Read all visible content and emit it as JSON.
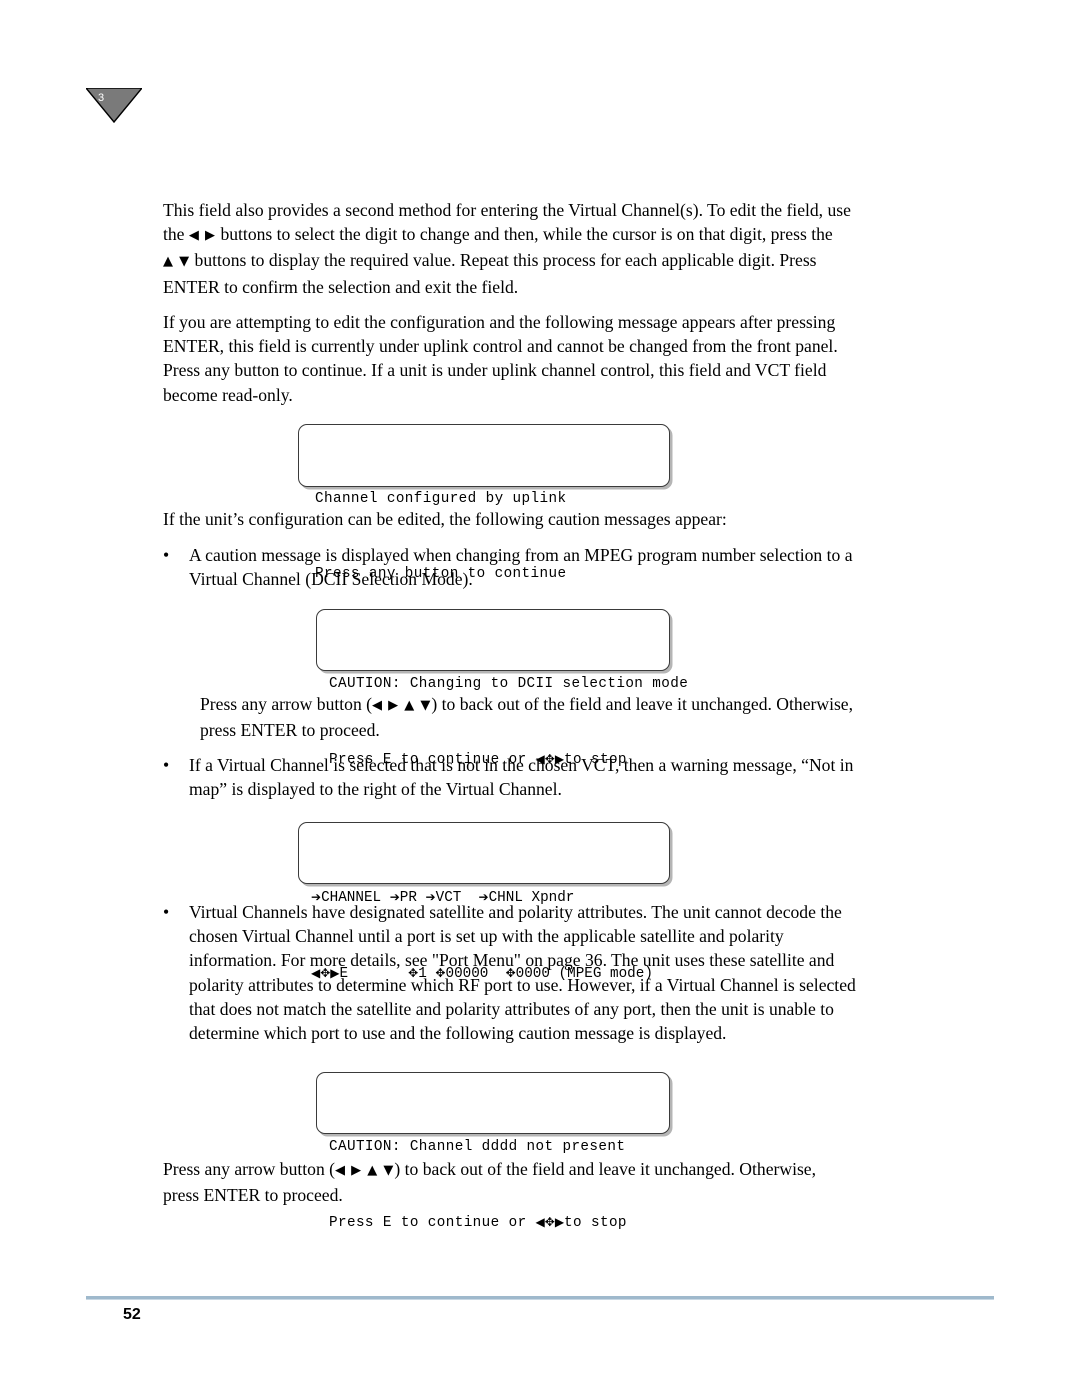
{
  "chapter_marker": {
    "number": "3"
  },
  "paragraphs": {
    "p1_a": "This field also provides a second method for entering the Virtual Channel(s). To edit the field, use",
    "p1_b_pre": "the",
    "p1_b_arrows": "◀ ▶",
    "p1_b_post": "buttons to select the digit to change and then, while the cursor is on that digit, press the",
    "p1_c_arrows": "▲ ▼",
    "p1_c_post": "buttons to display the required value. Repeat this process for each applicable digit. Press",
    "p1_d": "ENTER to confirm the selection and exit the field.",
    "p2_a": "If you are attempting to edit the configuration and the following message appears after pressing",
    "p2_b": "ENTER, this field is currently under uplink control and cannot be changed from the front panel.",
    "p2_c": "Press any button to continue. If a unit is under uplink channel control, this field and VCT field",
    "p2_d": "become read-only.",
    "p3": "If the unit’s configuration can be edited, the following caution messages appear:",
    "bullet1_l1": "A caution message is displayed when changing from an MPEG program number selection to a",
    "bullet1_l2": "Virtual Channel (DCII Selection Mode).",
    "p4_pre": "Press any arrow button (",
    "p4_arrows": "◀  ▶  ▲  ▼",
    "p4_post": ") to back out of the field and leave it unchanged. Otherwise,",
    "p4_l2": "press ENTER to proceed.",
    "bullet2_l1": "If a Virtual Channel is selected that is not in the chosen VCT, then a warning message, “Not in",
    "bullet2_l2": "map” is displayed to the right of the Virtual Channel.",
    "bullet3_l1": "Virtual Channels have designated satellite and polarity attributes. The unit cannot decode the",
    "bullet3_l2": "chosen Virtual Channel until a port is set up with the applicable satellite and polarity",
    "bullet3_l3": "information. For more details, see \"Port Menu\" on page 36. The unit uses these satellite and",
    "bullet3_l4": "polarity attributes to determine which RF port to use. However, if a Virtual Channel is selected",
    "bullet3_l5": "that does not match the satellite and polarity attributes of any port, then the unit is unable to",
    "bullet3_l6": "determine which port to use and the following caution message is displayed.",
    "p5_pre": "Press any arrow button (",
    "p5_arrows": "◀  ▶  ▲  ▼",
    "p5_post": ") to back out of the field and leave it unchanged. Otherwise,",
    "p5_l2": "press ENTER to proceed.",
    "bullet_char": "•"
  },
  "lcd_boxes": {
    "box1": {
      "line1": "Channel configured by uplink",
      "line2": "Press any button to continue"
    },
    "box2": {
      "line1": "CAUTION: Changing to DCII selection mode",
      "line2_pre": "Press E to continue or ",
      "line2_glyphs": "◀✥▶",
      "line2_post": "to stop"
    },
    "box3": {
      "line1_a": "CHANNEL",
      "line1_b": "PR",
      "line1_c": "VCT",
      "line1_d": "CHNL Xpndr",
      "line2_glyphs": "◀✥▶",
      "line2_a": "E",
      "line2_b": "1",
      "line2_c": "00000",
      "line2_d": "0000",
      "line2_e": "(MPEG mode)"
    },
    "box4": {
      "line1": "CAUTION: Channel dddd not present",
      "line2_pre": "Press E to continue or ",
      "line2_glyphs": "◀✥▶",
      "line2_post": "to stop"
    }
  },
  "footer": {
    "page_number": "52"
  }
}
